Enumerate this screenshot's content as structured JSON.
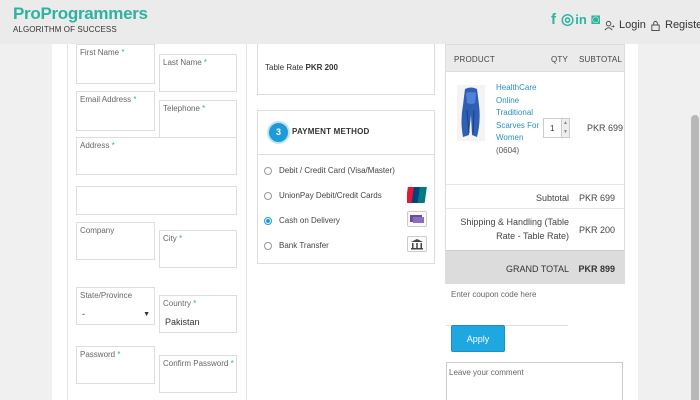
{
  "brand": {
    "name": "ProProgrammers",
    "tagline": "ALGORITHM OF SUCCESS"
  },
  "social": [
    {
      "glyph": "f",
      "icon": "facebook-icon"
    },
    {
      "glyph": "◎",
      "icon": "instagram-icon"
    },
    {
      "glyph": "in",
      "icon": "linkedin-icon"
    },
    {
      "glyph": "◙",
      "icon": "whatsapp-icon"
    }
  ],
  "nav": {
    "login": "Login",
    "register": "Register"
  },
  "form": {
    "first_name": "First Name",
    "last_name": "Last Name",
    "email": "Email Address",
    "telephone": "Telephone",
    "address": "Address",
    "company": "Company",
    "city": "City",
    "state": "State/Province",
    "state_value": "-",
    "country": "Country",
    "country_value": "Pakistan",
    "password": "Password",
    "confirm_password": "Confirm Password",
    "required_mark": "*"
  },
  "shipping": {
    "label": "Table Rate",
    "amount": "PKR 200"
  },
  "payment": {
    "step": "3",
    "title": "PAYMENT METHOD",
    "options": [
      {
        "label": "Debit / Credit Card (Visa/Master)",
        "selected": false,
        "icon": ""
      },
      {
        "label": "UnionPay Debit/Credit Cards",
        "selected": false,
        "icon": "unionpay-icon"
      },
      {
        "label": "Cash on Delivery",
        "selected": true,
        "icon": "cash-icon"
      },
      {
        "label": "Bank Transfer",
        "selected": false,
        "icon": "bank-icon"
      }
    ]
  },
  "summary": {
    "headers": {
      "product": "PRODUCT",
      "qty": "QTY",
      "subtotal": "SUBTOTAL"
    },
    "item": {
      "name_lines": [
        "HealthCare",
        "Online",
        "Traditional",
        "Scarves For",
        "Women"
      ],
      "code": "(0604)",
      "qty": "1",
      "subtotal": "PKR 699"
    },
    "subtotal_label": "Subtotal",
    "subtotal_value": "PKR 699",
    "shipping_label_1": "Shipping & Handling (Table",
    "shipping_label_2": "Rate - Table Rate)",
    "shipping_value": "PKR 200",
    "grand_label": "GRAND TOTAL",
    "grand_value": "PKR 899"
  },
  "coupon": {
    "placeholder": "Enter coupon code here",
    "button": "Apply"
  },
  "comment": {
    "placeholder": "Leave your comment"
  },
  "colors": {
    "brand": "#2db3a0",
    "accent": "#1e9ad6"
  }
}
